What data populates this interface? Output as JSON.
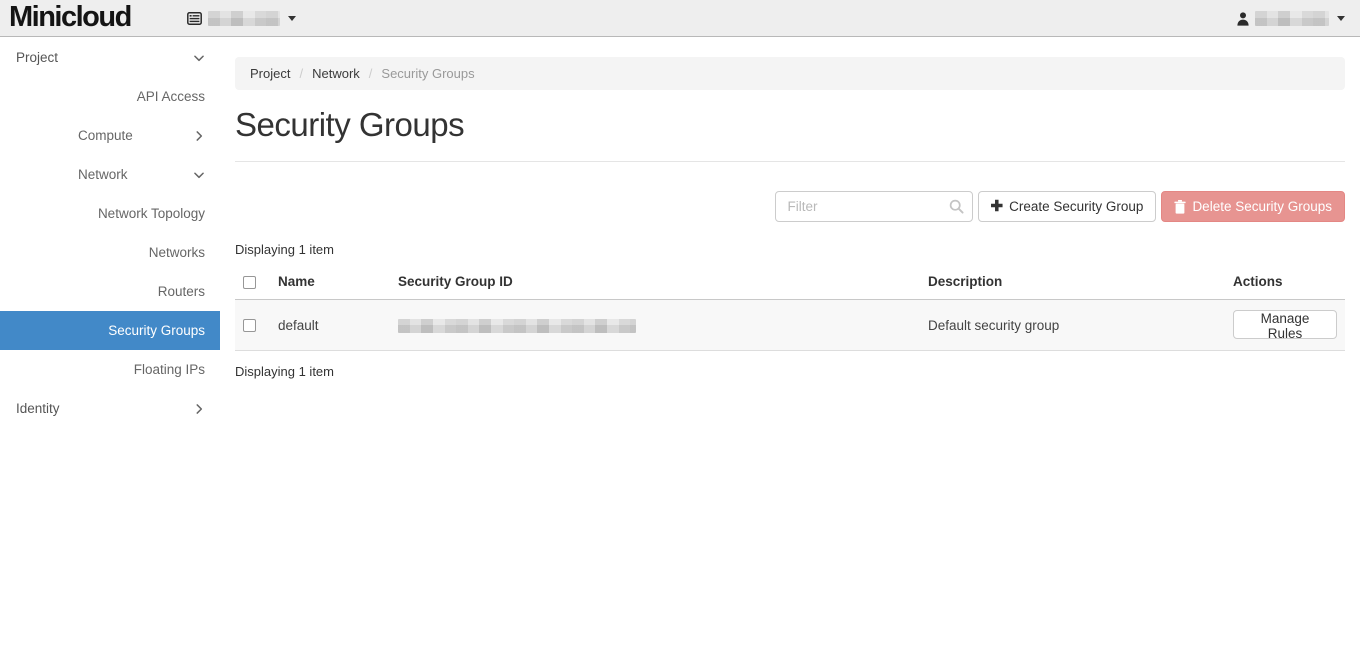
{
  "navbar": {
    "brand": "Minicloud",
    "project_selector": {
      "redacted": true,
      "icon": "project-list-icon",
      "caret": "caret-down-icon"
    },
    "user_menu": {
      "redacted": true,
      "icon": "user-icon",
      "caret": "caret-down-icon"
    }
  },
  "sidebar": {
    "items": [
      {
        "label": "Project",
        "level": 1,
        "chevron": "down",
        "active": false
      },
      {
        "label": "API Access",
        "level": 3,
        "chevron": null,
        "active": false
      },
      {
        "label": "Compute",
        "level": 2,
        "chevron": "right",
        "active": false
      },
      {
        "label": "Network",
        "level": 2,
        "chevron": "down",
        "active": false
      },
      {
        "label": "Network Topology",
        "level": 3,
        "chevron": null,
        "active": false
      },
      {
        "label": "Networks",
        "level": 3,
        "chevron": null,
        "active": false
      },
      {
        "label": "Routers",
        "level": 3,
        "chevron": null,
        "active": false
      },
      {
        "label": "Security Groups",
        "level": 3,
        "chevron": null,
        "active": true
      },
      {
        "label": "Floating IPs",
        "level": 3,
        "chevron": null,
        "active": false
      },
      {
        "label": "Identity",
        "level": 1,
        "chevron": "right",
        "active": false
      }
    ]
  },
  "breadcrumb": {
    "items": [
      "Project",
      "Network",
      "Security Groups"
    ],
    "separator": "/"
  },
  "page": {
    "title": "Security Groups"
  },
  "toolbar": {
    "filter_placeholder": "Filter",
    "create_label": "Create Security Group",
    "delete_label": "Delete Security Groups",
    "create_icon": "plus-icon",
    "delete_icon": "trash-icon",
    "filter_icon": "search-icon"
  },
  "table": {
    "count_top": "Displaying 1 item",
    "count_bottom": "Displaying 1 item",
    "headers": [
      "Name",
      "Security Group ID",
      "Description",
      "Actions"
    ],
    "rows": [
      {
        "name": "default",
        "security_group_id_redacted": true,
        "description": "Default security group",
        "action_label": "Manage Rules"
      }
    ]
  },
  "colors": {
    "active_nav": "#4289c8",
    "delete_button": "#d9534f",
    "navbar_bg": "#eeeeee",
    "breadcrumb_bg": "#f4f4f4",
    "row_bg": "#f8f8f8"
  }
}
